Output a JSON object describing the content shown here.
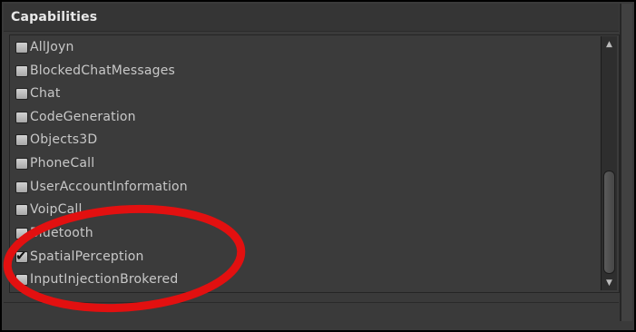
{
  "section": {
    "title": "Capabilities"
  },
  "capabilities": [
    {
      "label": "AllJoyn",
      "checked": false
    },
    {
      "label": "BlockedChatMessages",
      "checked": false
    },
    {
      "label": "Chat",
      "checked": false
    },
    {
      "label": "CodeGeneration",
      "checked": false
    },
    {
      "label": "Objects3D",
      "checked": false
    },
    {
      "label": "PhoneCall",
      "checked": false
    },
    {
      "label": "UserAccountInformation",
      "checked": false
    },
    {
      "label": "VoipCall",
      "checked": false
    },
    {
      "label": "Bluetooth",
      "checked": false
    },
    {
      "label": "SpatialPerception",
      "checked": true
    },
    {
      "label": "InputInjectionBrokered",
      "checked": false
    }
  ],
  "scrollbar": {
    "up_glyph": "▲",
    "down_glyph": "▼"
  },
  "colors": {
    "annotation": "#e21010",
    "background": "#3b3b3b",
    "text": "#c8c8c8"
  }
}
